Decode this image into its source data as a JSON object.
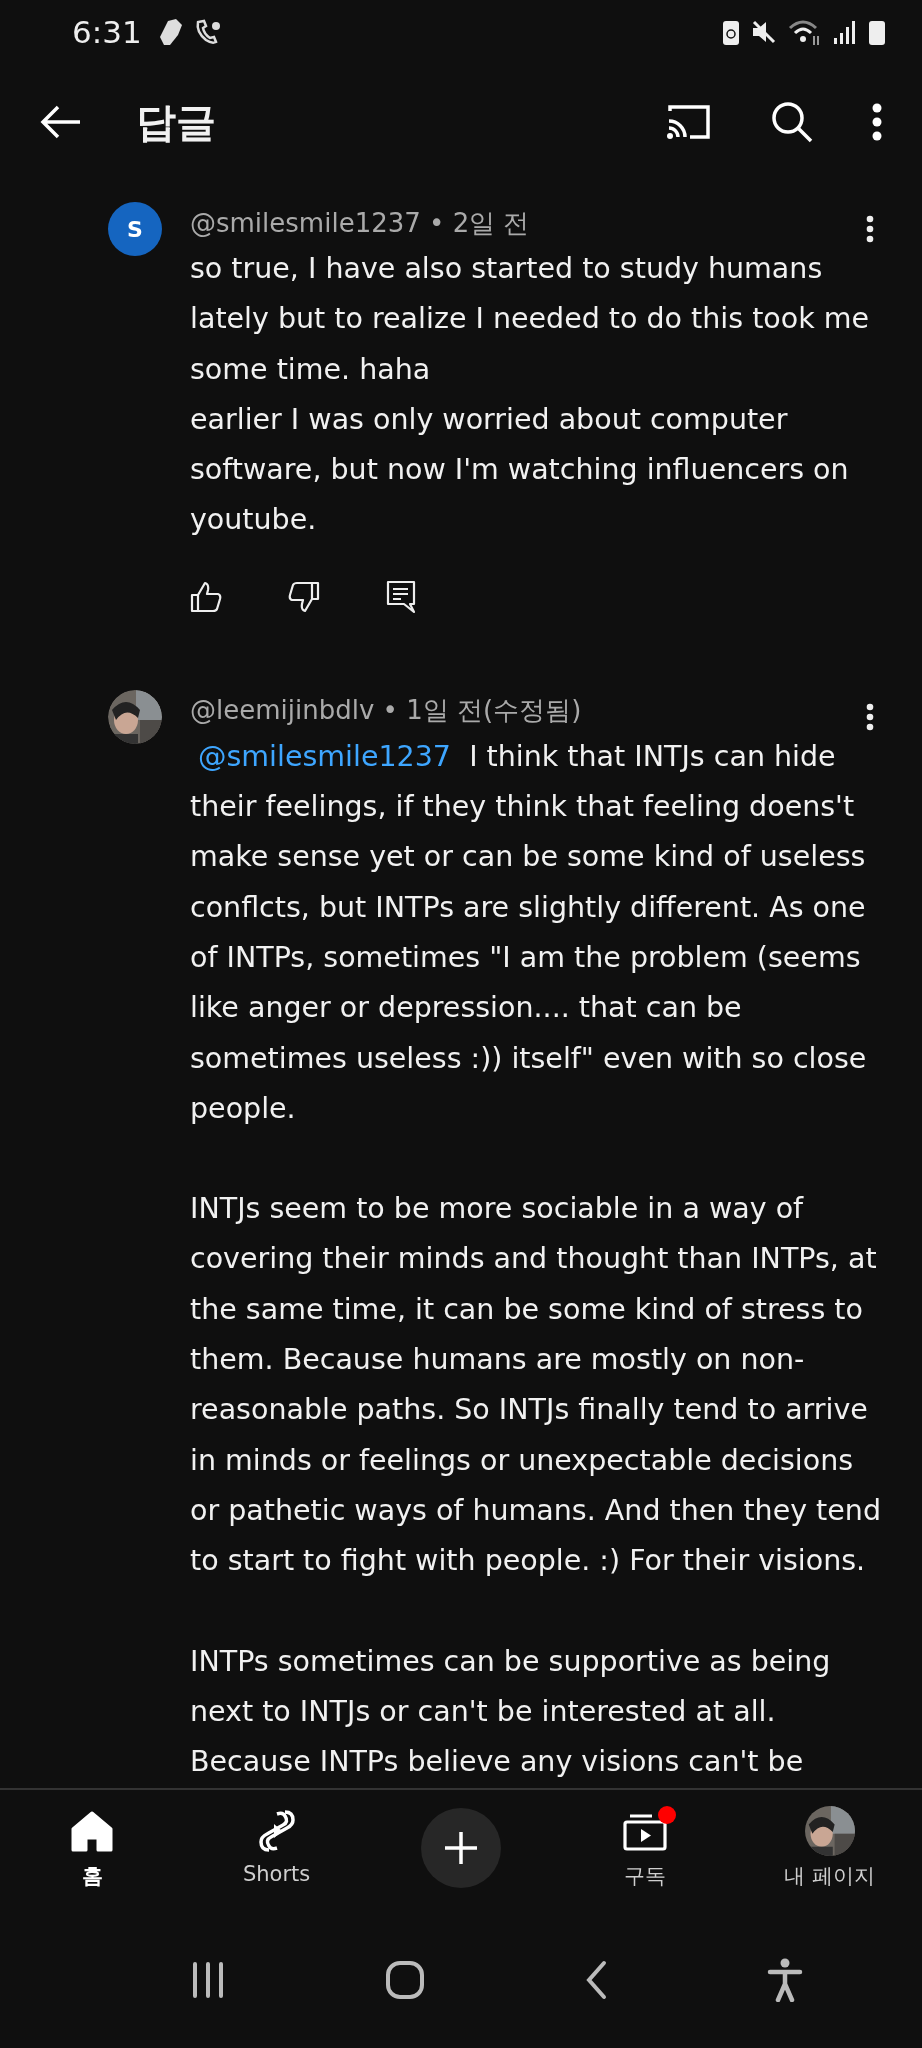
{
  "status_bar": {
    "time": "6:31"
  },
  "top_bar": {
    "title": "답글"
  },
  "comments": [
    {
      "author": "@smilesmile1237",
      "separator": "•",
      "time": "2일 전",
      "avatar": {
        "kind": "letter",
        "letter": "S",
        "color": "#1565c0"
      },
      "paragraphs": [
        {
          "text": "so true, I have also started to study humans lately but to realize I needed to do this took me some time. haha\nearlier I was only worried about computer software, but now I'm watching influencers on youtube."
        }
      ],
      "actions": true
    },
    {
      "author": "@leemijinbdlv",
      "separator": "•",
      "time": "1일 전(수정됨)",
      "paragraphs": [
        {
          "mention": "@smilesmile1237",
          "text": "I think that INTJs can hide their feelings, if they think that feeling doens't make sense yet or can be some kind of useless conflcts, but INTPs are slightly different. As one of INTPs, sometimes \"I am the problem (seems like anger or depression.... that can be sometimes useless :)) itself\" even with so close people."
        },
        {
          "text": "INTJs seem to be more sociable in a way of covering their minds and thought than INTPs, at the same time, it can be some kind of stress to them. Because humans are mostly on non-reasonable paths. So INTJs finally tend to arrive in minds or feelings or unexpectable decisions or pathetic ways of humans. And then they tend to start to fight with people. :) For their visions."
        },
        {
          "text": "INTPs sometimes can be supportive as being next to INTJs or can't be interested at all. Because INTPs believe any visions can't be"
        }
      ],
      "actions": false
    }
  ],
  "bottom_nav": [
    {
      "kind": "home",
      "label": "홈",
      "selected": true,
      "badge": false
    },
    {
      "kind": "shorts",
      "label": "Shorts",
      "selected": false,
      "badge": false
    },
    {
      "kind": "create"
    },
    {
      "kind": "subscriptions",
      "label": "구독",
      "selected": false,
      "badge": true
    },
    {
      "kind": "profile",
      "label": "내 페이지",
      "selected": false,
      "badge": false
    }
  ]
}
